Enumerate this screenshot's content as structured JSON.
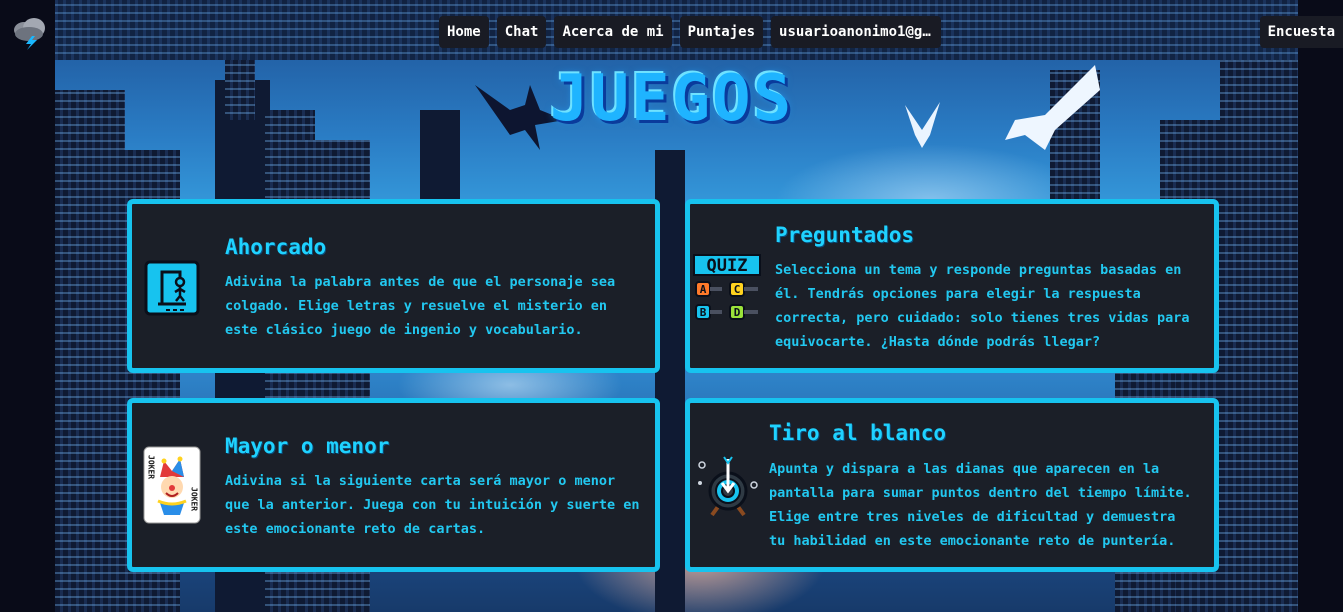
{
  "header": {
    "nav": [
      {
        "label": "Home"
      },
      {
        "label": "Chat"
      },
      {
        "label": "Acerca de mi"
      },
      {
        "label": "Puntajes"
      },
      {
        "label": "usuarioanonimo1@g..."
      }
    ],
    "survey_label": "Encuesta"
  },
  "page_title": "JUEGOS",
  "games": [
    {
      "title": "Ahorcado",
      "description": "Adivina la palabra antes de que el personaje sea colgado. Elige letras y resuelve el misterio en este clásico juego de ingenio y vocabulario.",
      "icon": "hangman-icon"
    },
    {
      "title": "Preguntados",
      "description": "Selecciona un tema y responde preguntas basadas en él. Tendrás opciones para elegir la respuesta correcta, pero cuidado: solo tienes tres vidas para equivocarte. ¿Hasta dónde podrás llegar?",
      "icon": "quiz-icon",
      "icon_text": "QUIZ",
      "icon_options": [
        "A",
        "C",
        "B",
        "D"
      ]
    },
    {
      "title": "Mayor o menor",
      "description": "Adivina si la siguiente carta será mayor o menor que la anterior. Juega con tu intuición y suerte en este emocionante reto de cartas.",
      "icon": "joker-card-icon",
      "icon_text": "JOKER"
    },
    {
      "title": "Tiro al blanco",
      "description": "Apunta y dispara a las dianas que aparecen en la pantalla para sumar puntos dentro del tiempo límite. Elige entre tres niveles de dificultad y demuestra tu habilidad en este emocionante reto de puntería.",
      "icon": "target-icon"
    }
  ],
  "colors": {
    "accent": "#17c3ef",
    "card_bg": "#1b1f28",
    "nav_bg": "#191b24"
  }
}
